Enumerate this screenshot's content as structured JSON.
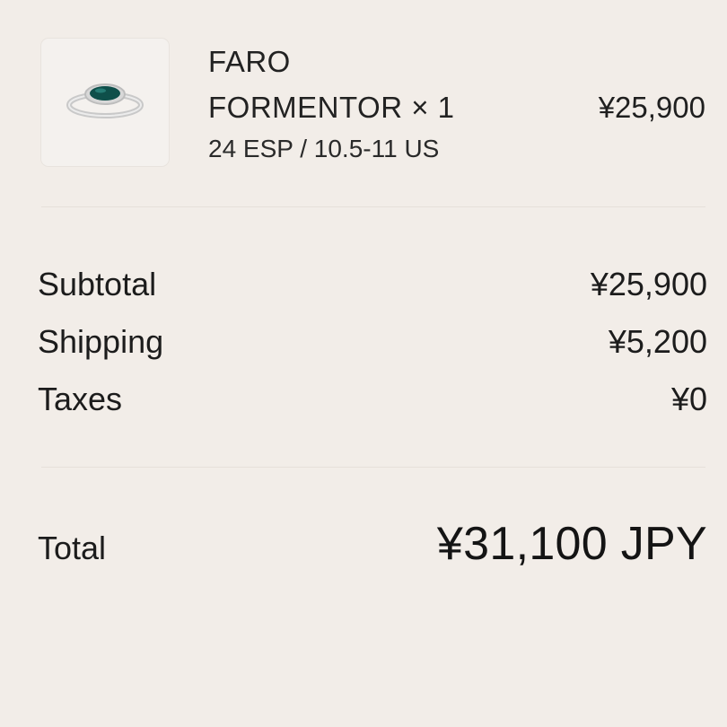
{
  "line_item": {
    "brand": "FARO",
    "name_qty": "FORMENTOR × 1",
    "variant": "24 ESP / 10.5-11 US",
    "price": "¥25,900",
    "image_icon": "ring-product-image"
  },
  "summary": {
    "subtotal_label": "Subtotal",
    "subtotal_value": "¥25,900",
    "shipping_label": "Shipping",
    "shipping_value": "¥5,200",
    "taxes_label": "Taxes",
    "taxes_value": "¥0"
  },
  "total": {
    "label": "Total",
    "value": "¥31,100 JPY"
  },
  "colors": {
    "background": "#f2ede8",
    "text": "#1a1a1a",
    "gem": "#0e4f4a"
  }
}
